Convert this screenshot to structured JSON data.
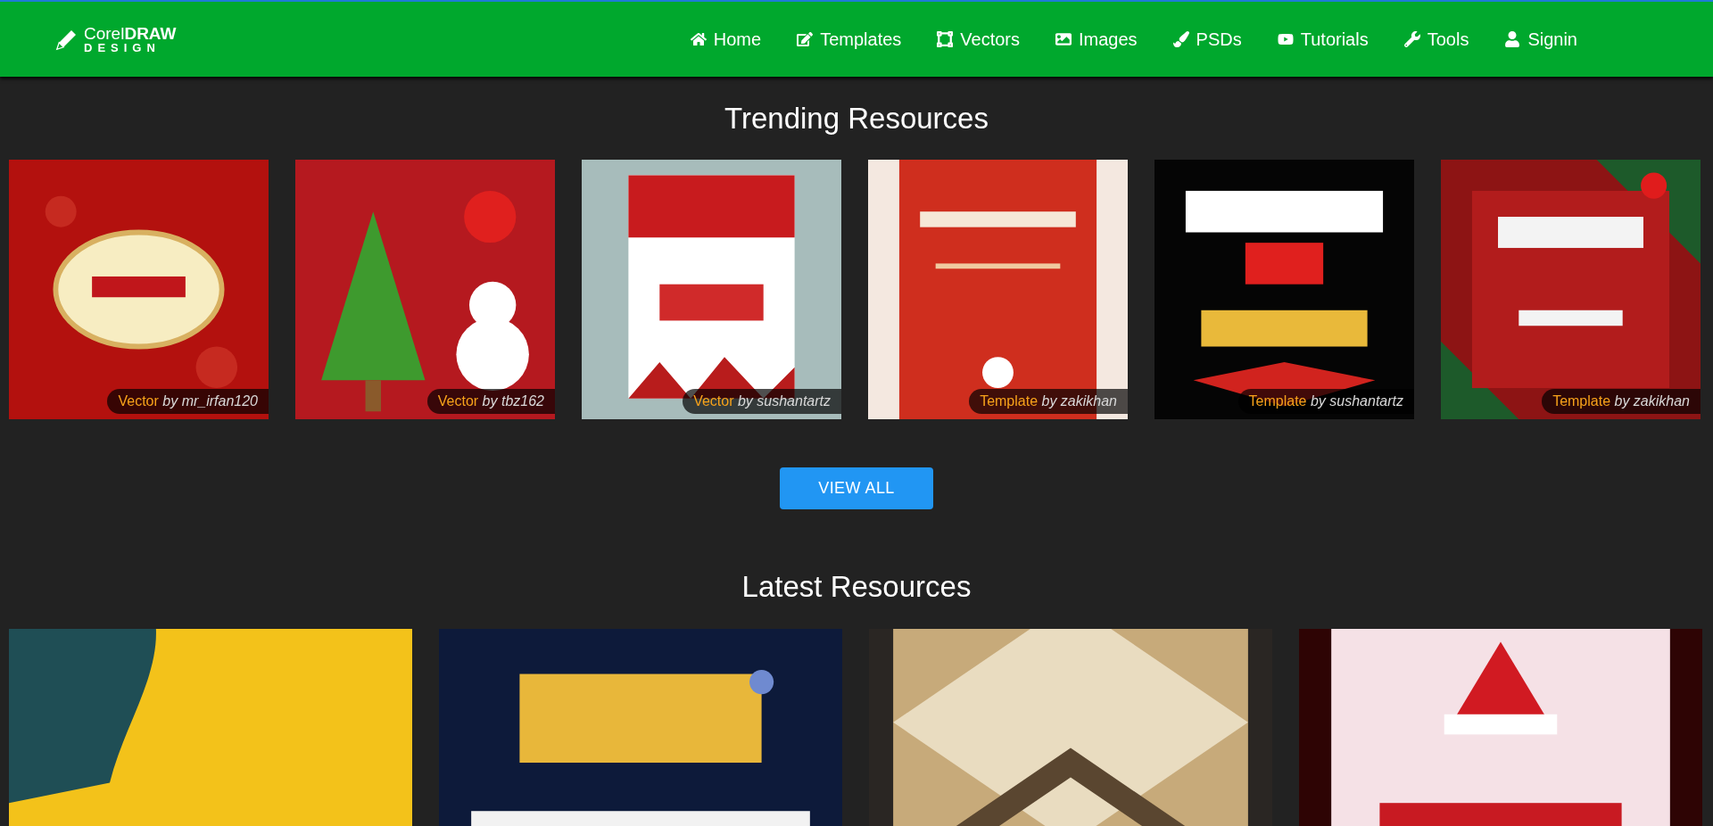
{
  "header": {
    "logo": {
      "title": "Corel**DRAW**",
      "subtitle": "DESIGN"
    },
    "nav": [
      {
        "label": "Home"
      },
      {
        "label": "Templates"
      },
      {
        "label": "Vectors"
      },
      {
        "label": "Images"
      },
      {
        "label": "PSDs"
      },
      {
        "label": "Tutorials"
      },
      {
        "label": "Tools"
      },
      {
        "label": "Signin"
      }
    ]
  },
  "trending": {
    "title": "Trending Resources",
    "cards": [
      {
        "kind": "picture",
        "type": "Vector",
        "author": "by mr_irfan120"
      },
      {
        "kind": "picture",
        "type": "Vector",
        "author": "by tbz162"
      },
      {
        "kind": "picture",
        "type": "Vector",
        "author": "by sushantartz"
      },
      {
        "kind": "picture",
        "type": "Template",
        "author": "by zakikhan"
      },
      {
        "kind": "picture",
        "type": "Template",
        "author": "by sushantartz"
      },
      {
        "kind": "picture",
        "type": "Template",
        "author": "by zakikhan"
      }
    ],
    "button": "VIEW ALL"
  },
  "latest": {
    "title": "Latest Resources"
  }
}
